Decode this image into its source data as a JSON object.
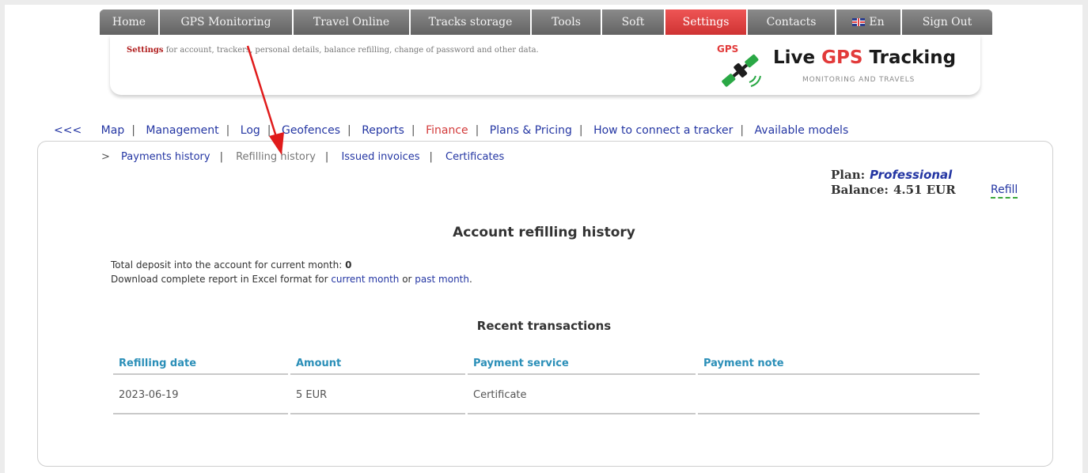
{
  "top_menu": {
    "items": [
      {
        "label": "Home"
      },
      {
        "label": "GPS Monitoring"
      },
      {
        "label": "Travel Online"
      },
      {
        "label": "Tracks storage"
      },
      {
        "label": "Tools"
      },
      {
        "label": "Soft"
      },
      {
        "label": "Settings"
      },
      {
        "label": "Contacts"
      },
      {
        "label": "En"
      },
      {
        "label": "Sign Out"
      }
    ],
    "active": "Settings"
  },
  "banner": {
    "desc_bold": "Settings",
    "desc_rest": " for account, trackers, personal details, balance refilling, change of password and other data.",
    "logo_mark_text": "GPS",
    "logo_title_1": "Live ",
    "logo_title_2": "GPS",
    "logo_title_3": " Tracking",
    "logo_sub": "MONITORING AND TRAVELS"
  },
  "sub_nav": {
    "back": "<<<",
    "items": [
      "Map",
      "Management",
      "Log",
      "Geofences",
      "Reports",
      "Finance",
      "Plans & Pricing",
      "How to connect a tracker",
      "Available models"
    ],
    "active": "Finance"
  },
  "finance_nav": {
    "arrow": ">",
    "items": [
      "Payments history",
      "Refilling history",
      "Issued invoices",
      "Certificates"
    ],
    "current": "Refilling history"
  },
  "account": {
    "plan_label": "Plan:",
    "plan_name": "Professional",
    "balance_label": "Balance:",
    "balance_value": "4.51 EUR",
    "refill_link": "Refill"
  },
  "main": {
    "title": "Account refilling history",
    "deposit_text": "Total deposit into the account for current month: ",
    "deposit_value": "0",
    "download_text_1": "Download complete report in Excel format for ",
    "download_link_1": "current month",
    "download_text_2": " or ",
    "download_link_2": "past month",
    "download_text_3": ".",
    "recent_title": "Recent transactions"
  },
  "transactions": {
    "headers": [
      "Refilling date",
      "Amount",
      "Payment service",
      "Payment note"
    ],
    "rows": [
      [
        "2023-06-19",
        "5 EUR",
        "Certificate",
        ""
      ]
    ]
  },
  "colors": {
    "active_menu": "#e04444",
    "link": "#2436a3",
    "header_cyan": "#2b8fb8",
    "annotation_arrow": "#e01b1b"
  }
}
